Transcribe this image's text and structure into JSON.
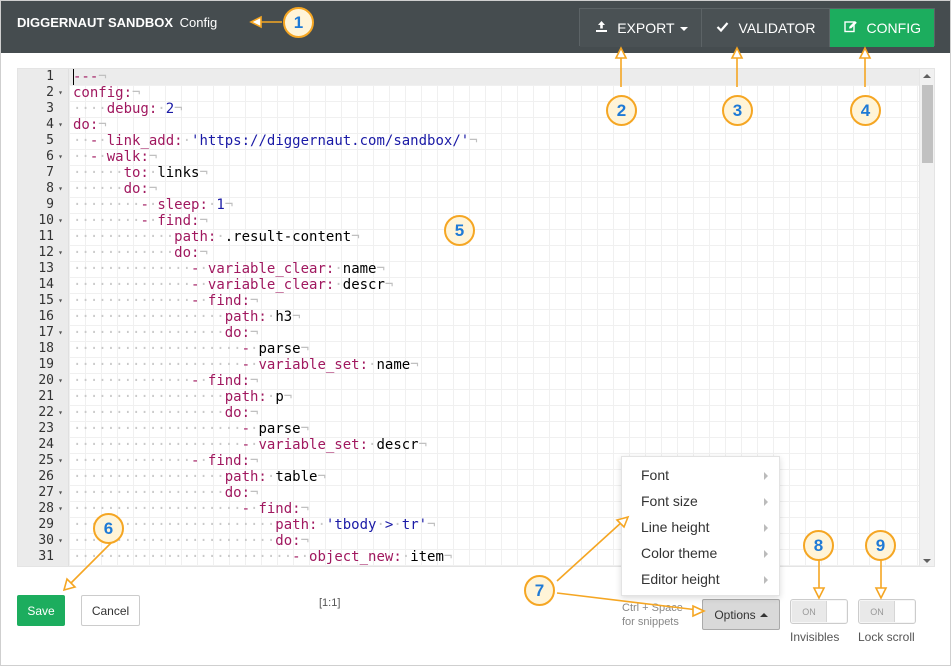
{
  "header": {
    "brand_bold": "DIGGERNAUT SANDBOX",
    "brand_light": "Config",
    "buttons": [
      {
        "label": "EXPORT",
        "icon": "upload-icon",
        "dropdown": true
      },
      {
        "label": "VALIDATOR",
        "icon": "check-icon"
      },
      {
        "label": "CONFIG",
        "icon": "edit-icon",
        "active": true
      }
    ]
  },
  "editor": {
    "lines": [
      {
        "n": "1",
        "fold": false,
        "text": "---"
      },
      {
        "n": "2",
        "fold": true,
        "text": "config:"
      },
      {
        "n": "3",
        "fold": false,
        "text": "    debug: 2"
      },
      {
        "n": "4",
        "fold": true,
        "text": "do:"
      },
      {
        "n": "5",
        "fold": false,
        "text": "  - link_add: 'https://diggernaut.com/sandbox/'"
      },
      {
        "n": "6",
        "fold": true,
        "text": "  - walk:"
      },
      {
        "n": "7",
        "fold": false,
        "text": "      to: links"
      },
      {
        "n": "8",
        "fold": true,
        "text": "      do:"
      },
      {
        "n": "9",
        "fold": false,
        "text": "        - sleep: 1"
      },
      {
        "n": "10",
        "fold": true,
        "text": "        - find:"
      },
      {
        "n": "11",
        "fold": false,
        "text": "            path: .result-content"
      },
      {
        "n": "12",
        "fold": true,
        "text": "            do:"
      },
      {
        "n": "13",
        "fold": false,
        "text": "              - variable_clear: name"
      },
      {
        "n": "14",
        "fold": false,
        "text": "              - variable_clear: descr"
      },
      {
        "n": "15",
        "fold": true,
        "text": "              - find:"
      },
      {
        "n": "16",
        "fold": false,
        "text": "                  path: h3"
      },
      {
        "n": "17",
        "fold": true,
        "text": "                  do:"
      },
      {
        "n": "18",
        "fold": false,
        "text": "                    - parse"
      },
      {
        "n": "19",
        "fold": false,
        "text": "                    - variable_set: name"
      },
      {
        "n": "20",
        "fold": true,
        "text": "              - find:"
      },
      {
        "n": "21",
        "fold": false,
        "text": "                  path: p"
      },
      {
        "n": "22",
        "fold": true,
        "text": "                  do:"
      },
      {
        "n": "23",
        "fold": false,
        "text": "                    - parse"
      },
      {
        "n": "24",
        "fold": false,
        "text": "                    - variable_set: descr"
      },
      {
        "n": "25",
        "fold": true,
        "text": "              - find:"
      },
      {
        "n": "26",
        "fold": false,
        "text": "                  path: table"
      },
      {
        "n": "27",
        "fold": true,
        "text": "                  do:"
      },
      {
        "n": "28",
        "fold": true,
        "text": "                    - find:"
      },
      {
        "n": "29",
        "fold": false,
        "text": "                        path: 'tbody > tr'"
      },
      {
        "n": "30",
        "fold": true,
        "text": "                        do:"
      },
      {
        "n": "31",
        "fold": false,
        "text": "                          - object_new: item"
      }
    ]
  },
  "footer": {
    "save_label": "Save",
    "cancel_label": "Cancel",
    "cursor_position": "[1:1]",
    "hint_line1": "Ctrl + Space",
    "hint_line2": "for snippets",
    "options_label": "Options",
    "invisibles_toggle": "ON",
    "invisibles_label": "Invisibles",
    "lockscroll_toggle": "ON",
    "lockscroll_label": "Lock scroll"
  },
  "options_menu": {
    "items": [
      "Font",
      "Font size",
      "Line height",
      "Color theme",
      "Editor height"
    ]
  },
  "annotations": [
    "1",
    "2",
    "3",
    "4",
    "5",
    "6",
    "7",
    "8",
    "9"
  ],
  "colors": {
    "header_bg": "#454c4f",
    "accent_green": "#1cad5e",
    "annotation_orange": "#f5a623",
    "annotation_number": "#1f7ad6",
    "yaml_key": "#a0185f",
    "yaml_value": "#1a1aa6"
  }
}
